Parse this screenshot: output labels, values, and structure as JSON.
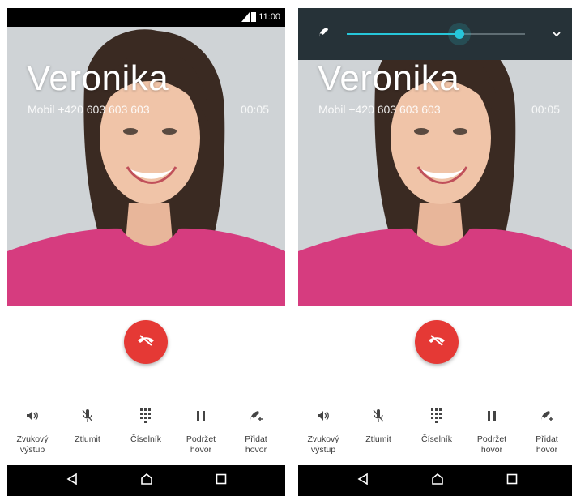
{
  "caller": {
    "name": "Veronika",
    "number_label": "Mobil +420 603 603 603",
    "duration": "00:05"
  },
  "status_bar": {
    "time": "11:00"
  },
  "volume": {
    "level": 0.63,
    "accent": "#26c6da"
  },
  "colors": {
    "end_call": "#e53935",
    "nav_bar": "#000000",
    "volume_panel": "#263238"
  },
  "actions": [
    {
      "id": "speaker",
      "label": "Zvukový\nvýstup",
      "icon": "speaker-icon"
    },
    {
      "id": "mute",
      "label": "Ztlumit",
      "icon": "mic-off-icon"
    },
    {
      "id": "dialpad",
      "label": "Číselník",
      "icon": "dialpad-icon"
    },
    {
      "id": "hold",
      "label": "Podržet\nhovor",
      "icon": "pause-icon"
    },
    {
      "id": "add-call",
      "label": "Přidat\nhovor",
      "icon": "add-call-icon"
    }
  ],
  "nav": [
    "back-icon",
    "home-icon",
    "recents-icon"
  ]
}
